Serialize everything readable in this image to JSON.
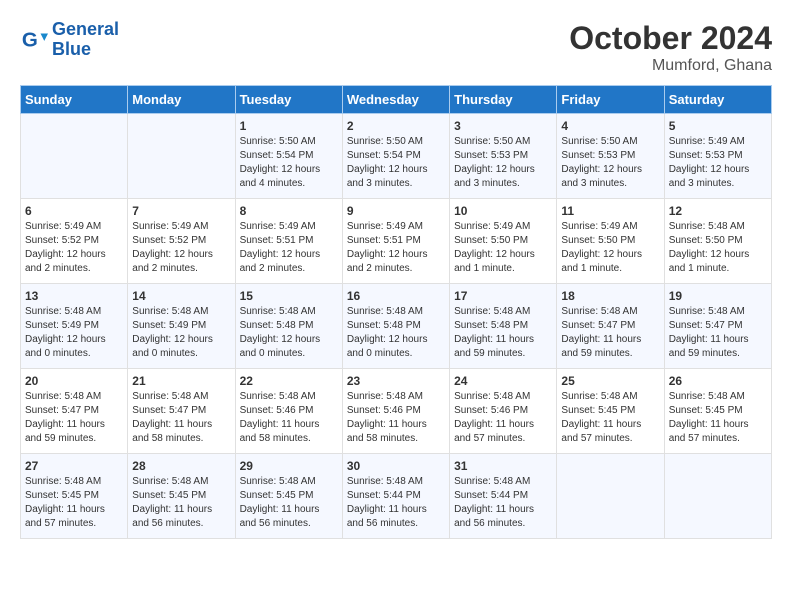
{
  "logo": {
    "line1": "General",
    "line2": "Blue"
  },
  "title": "October 2024",
  "location": "Mumford, Ghana",
  "days_of_week": [
    "Sunday",
    "Monday",
    "Tuesday",
    "Wednesday",
    "Thursday",
    "Friday",
    "Saturday"
  ],
  "weeks": [
    [
      {
        "day": "",
        "info": ""
      },
      {
        "day": "",
        "info": ""
      },
      {
        "day": "1",
        "info": "Sunrise: 5:50 AM\nSunset: 5:54 PM\nDaylight: 12 hours\nand 4 minutes."
      },
      {
        "day": "2",
        "info": "Sunrise: 5:50 AM\nSunset: 5:54 PM\nDaylight: 12 hours\nand 3 minutes."
      },
      {
        "day": "3",
        "info": "Sunrise: 5:50 AM\nSunset: 5:53 PM\nDaylight: 12 hours\nand 3 minutes."
      },
      {
        "day": "4",
        "info": "Sunrise: 5:50 AM\nSunset: 5:53 PM\nDaylight: 12 hours\nand 3 minutes."
      },
      {
        "day": "5",
        "info": "Sunrise: 5:49 AM\nSunset: 5:53 PM\nDaylight: 12 hours\nand 3 minutes."
      }
    ],
    [
      {
        "day": "6",
        "info": "Sunrise: 5:49 AM\nSunset: 5:52 PM\nDaylight: 12 hours\nand 2 minutes."
      },
      {
        "day": "7",
        "info": "Sunrise: 5:49 AM\nSunset: 5:52 PM\nDaylight: 12 hours\nand 2 minutes."
      },
      {
        "day": "8",
        "info": "Sunrise: 5:49 AM\nSunset: 5:51 PM\nDaylight: 12 hours\nand 2 minutes."
      },
      {
        "day": "9",
        "info": "Sunrise: 5:49 AM\nSunset: 5:51 PM\nDaylight: 12 hours\nand 2 minutes."
      },
      {
        "day": "10",
        "info": "Sunrise: 5:49 AM\nSunset: 5:50 PM\nDaylight: 12 hours\nand 1 minute."
      },
      {
        "day": "11",
        "info": "Sunrise: 5:49 AM\nSunset: 5:50 PM\nDaylight: 12 hours\nand 1 minute."
      },
      {
        "day": "12",
        "info": "Sunrise: 5:48 AM\nSunset: 5:50 PM\nDaylight: 12 hours\nand 1 minute."
      }
    ],
    [
      {
        "day": "13",
        "info": "Sunrise: 5:48 AM\nSunset: 5:49 PM\nDaylight: 12 hours\nand 0 minutes."
      },
      {
        "day": "14",
        "info": "Sunrise: 5:48 AM\nSunset: 5:49 PM\nDaylight: 12 hours\nand 0 minutes."
      },
      {
        "day": "15",
        "info": "Sunrise: 5:48 AM\nSunset: 5:48 PM\nDaylight: 12 hours\nand 0 minutes."
      },
      {
        "day": "16",
        "info": "Sunrise: 5:48 AM\nSunset: 5:48 PM\nDaylight: 12 hours\nand 0 minutes."
      },
      {
        "day": "17",
        "info": "Sunrise: 5:48 AM\nSunset: 5:48 PM\nDaylight: 11 hours\nand 59 minutes."
      },
      {
        "day": "18",
        "info": "Sunrise: 5:48 AM\nSunset: 5:47 PM\nDaylight: 11 hours\nand 59 minutes."
      },
      {
        "day": "19",
        "info": "Sunrise: 5:48 AM\nSunset: 5:47 PM\nDaylight: 11 hours\nand 59 minutes."
      }
    ],
    [
      {
        "day": "20",
        "info": "Sunrise: 5:48 AM\nSunset: 5:47 PM\nDaylight: 11 hours\nand 59 minutes."
      },
      {
        "day": "21",
        "info": "Sunrise: 5:48 AM\nSunset: 5:47 PM\nDaylight: 11 hours\nand 58 minutes."
      },
      {
        "day": "22",
        "info": "Sunrise: 5:48 AM\nSunset: 5:46 PM\nDaylight: 11 hours\nand 58 minutes."
      },
      {
        "day": "23",
        "info": "Sunrise: 5:48 AM\nSunset: 5:46 PM\nDaylight: 11 hours\nand 58 minutes."
      },
      {
        "day": "24",
        "info": "Sunrise: 5:48 AM\nSunset: 5:46 PM\nDaylight: 11 hours\nand 57 minutes."
      },
      {
        "day": "25",
        "info": "Sunrise: 5:48 AM\nSunset: 5:45 PM\nDaylight: 11 hours\nand 57 minutes."
      },
      {
        "day": "26",
        "info": "Sunrise: 5:48 AM\nSunset: 5:45 PM\nDaylight: 11 hours\nand 57 minutes."
      }
    ],
    [
      {
        "day": "27",
        "info": "Sunrise: 5:48 AM\nSunset: 5:45 PM\nDaylight: 11 hours\nand 57 minutes."
      },
      {
        "day": "28",
        "info": "Sunrise: 5:48 AM\nSunset: 5:45 PM\nDaylight: 11 hours\nand 56 minutes."
      },
      {
        "day": "29",
        "info": "Sunrise: 5:48 AM\nSunset: 5:45 PM\nDaylight: 11 hours\nand 56 minutes."
      },
      {
        "day": "30",
        "info": "Sunrise: 5:48 AM\nSunset: 5:44 PM\nDaylight: 11 hours\nand 56 minutes."
      },
      {
        "day": "31",
        "info": "Sunrise: 5:48 AM\nSunset: 5:44 PM\nDaylight: 11 hours\nand 56 minutes."
      },
      {
        "day": "",
        "info": ""
      },
      {
        "day": "",
        "info": ""
      }
    ]
  ]
}
